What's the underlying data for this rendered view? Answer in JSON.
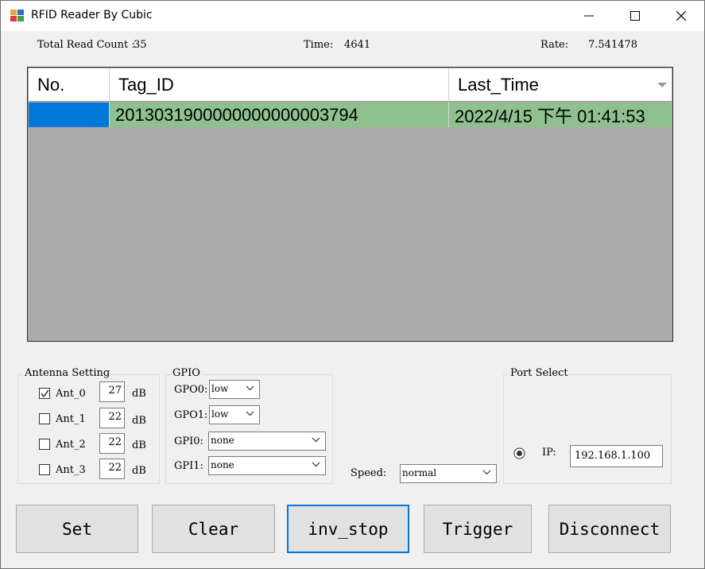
{
  "window": {
    "title": "RFID Reader By Cubic"
  },
  "info": {
    "total_read_count_label": "Total Read Count :",
    "total_read_count_value": "35",
    "time_label": "Time:",
    "time_value": "4641",
    "rate_label": "Rate:",
    "rate_value": "7.541478"
  },
  "grid": {
    "columns": [
      "No.",
      "Tag_ID",
      "Last_Time"
    ],
    "rows": [
      {
        "no": "",
        "tag_id": "2013031900000000000003794",
        "last_time": "2022/4/15 下午 01:41:53"
      }
    ],
    "row_color": "#8fc18f",
    "selection_color": "#0078d7",
    "background_color": "#ababab"
  },
  "antenna": {
    "legend": "Antenna Setting",
    "unit": "dB",
    "items": [
      {
        "label": "Ant_0",
        "checked": true,
        "value": "27"
      },
      {
        "label": "Ant_1",
        "checked": false,
        "value": "22"
      },
      {
        "label": "Ant_2",
        "checked": false,
        "value": "22"
      },
      {
        "label": "Ant_3",
        "checked": false,
        "value": "22"
      }
    ]
  },
  "gpio": {
    "legend": "GPIO",
    "gpo0_label": "GPO0:",
    "gpo0_value": "low",
    "gpo1_label": "GPO1:",
    "gpo1_value": "low",
    "gpi0_label": "GPI0:",
    "gpi0_value": "none",
    "gpi1_label": "GPI1:",
    "gpi1_value": "none"
  },
  "speed": {
    "label": "Speed:",
    "value": "normal"
  },
  "port": {
    "legend": "Port Select",
    "ip_label": "IP:",
    "ip_value": "192.168.1.100",
    "selected": true
  },
  "buttons": {
    "set": "Set",
    "clear": "Clear",
    "inv_stop": "inv_stop",
    "trigger": "Trigger",
    "disconnect": "Disconnect"
  },
  "accent_color": "#0078d7"
}
